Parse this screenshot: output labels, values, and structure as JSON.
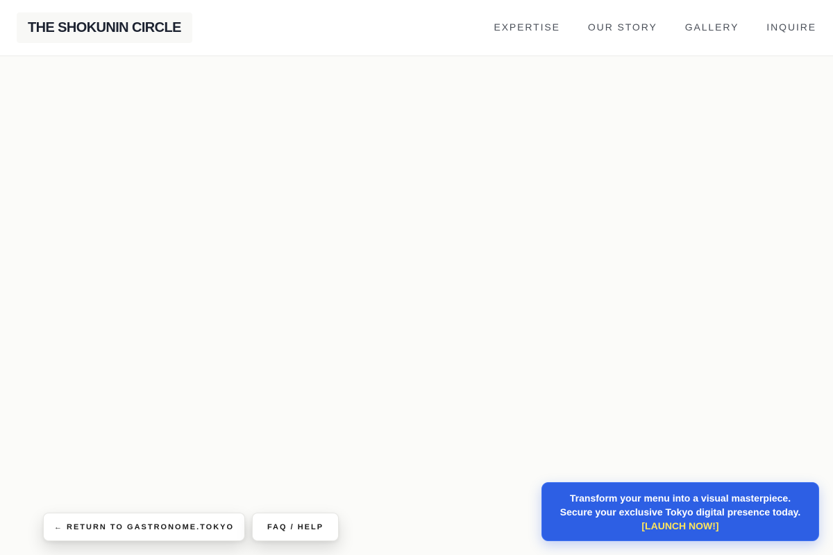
{
  "header": {
    "logo": "THE SHOKUNIN CIRCLE",
    "nav": [
      {
        "label": "EXPERTISE"
      },
      {
        "label": "OUR STORY"
      },
      {
        "label": "GALLERY"
      },
      {
        "label": "INQUIRE"
      }
    ]
  },
  "footer_actions": {
    "return_label": "← RETURN TO GASTRONOME.TOKYO",
    "faq_label": "FAQ / HELP"
  },
  "promo": {
    "line1": "Transform your menu into a visual masterpiece.",
    "line2": "Secure your exclusive Tokyo digital presence today.",
    "cta": "[LAUNCH NOW!]"
  },
  "colors": {
    "background": "#fbfbf9",
    "header_bg": "#ffffff",
    "promo_bg": "#2d5fe4",
    "promo_cta": "#ffe55c"
  }
}
